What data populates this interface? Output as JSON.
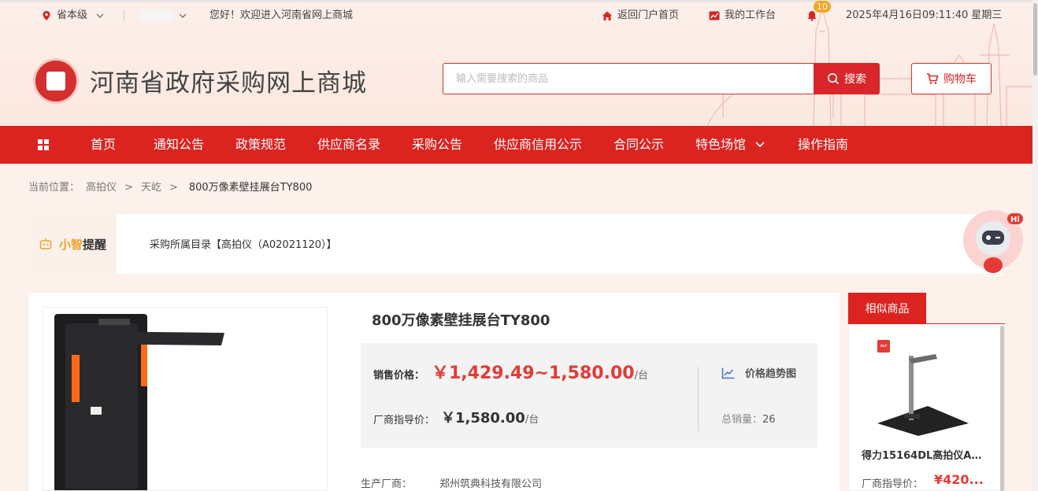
{
  "colors": {
    "accent": "#db2320",
    "price": "#e43a36",
    "badge": "#f5a623"
  },
  "topbar": {
    "region": "省本级",
    "greeting": "您好！欢迎进入河南省网上商城",
    "portal_link": "返回门户首页",
    "workspace_link": "我的工作台",
    "notification_count": "10",
    "datetime": "2025年4月16日09:11:40 星期三"
  },
  "header": {
    "site_title": "河南省政府采购网上商城",
    "search_placeholder": "输入需要搜索的商品",
    "search_label": "搜索",
    "cart_label": "购物车"
  },
  "nav": {
    "items": [
      "首页",
      "通知公告",
      "政策规范",
      "供应商名录",
      "采购公告",
      "供应商信用公示",
      "合同公示",
      "特色场馆",
      "操作指南"
    ]
  },
  "breadcrumb": {
    "prefix": "当前位置：",
    "items": [
      "高拍仪",
      "天屹"
    ],
    "separator": ">",
    "current": "800万像素壁挂展台TY800"
  },
  "tip": {
    "tag_a": "小智",
    "tag_b": "提醒",
    "text": "采购所属目录【高拍仪（A02021120）】"
  },
  "product": {
    "title": "800万像素壁挂展台TY800",
    "sale_price_label": "销售价格：",
    "sale_price": "￥1,429.49~1,580.00",
    "unit": "/台",
    "guide_price_label": "厂商指导价：",
    "guide_price": "￥1,580.00",
    "trend_label": "价格趋势图",
    "sales_label": "总销量：",
    "sales_count": "26",
    "maker_label": "生产厂商：",
    "maker": "郑州筑典科技有限公司"
  },
  "similar": {
    "tab_label": "相似商品",
    "items": [
      {
        "name": "得力15164DL高拍仪A4软...",
        "price_label": "厂商指导价：",
        "price": "¥420...",
        "brand_mark": "deli"
      }
    ]
  }
}
